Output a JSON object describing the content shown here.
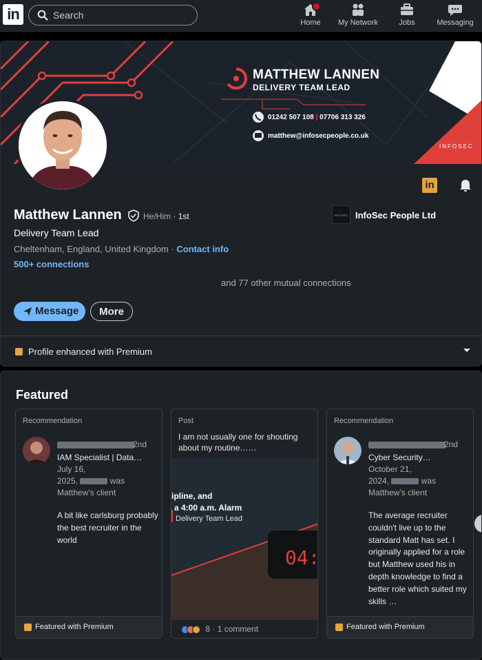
{
  "nav": {
    "search_placeholder": "Search",
    "items": [
      {
        "label": "Home",
        "icon": "home-icon"
      },
      {
        "label": "My Network",
        "icon": "network-icon"
      },
      {
        "label": "Jobs",
        "icon": "briefcase-icon"
      },
      {
        "label": "Messaging",
        "icon": "messaging-icon"
      }
    ],
    "logo_text": "in"
  },
  "banner": {
    "name": "MATTHEW LANNEN",
    "title": "DELIVERY TEAM LEAD",
    "phone": "01242 507 108",
    "phone_sep": "|",
    "mobile": "07706 313 326",
    "email": "matthew@infosecpeople.co.uk",
    "brand": "INFOSEC"
  },
  "profile": {
    "name": "Matthew Lannen",
    "pronouns": "He/Him",
    "degree": "· 1st",
    "headline": "Delivery Team Lead",
    "location": "Cheltenham, England, United Kingdom · ",
    "contact_link": "Contact info",
    "connections": "500+ connections",
    "mutual": "and 77 other mutual connections",
    "company": "InfoSec People Ltd",
    "company_logo_text": "INFOSEC",
    "message_btn": "Message",
    "more_btn": "More",
    "premium_note": "Profile enhanced with Premium"
  },
  "featured": {
    "title": "Featured",
    "cards": [
      {
        "type": "Recommendation",
        "degree": "2nd",
        "role": "IAM Specialist | Data…",
        "date_line1": "July 16,",
        "date_line2_pre": "2025,",
        "date_line2_post": "was",
        "relation": "Matthew’s client",
        "body": "A bit like carlsburg probably the best recruiter in the world",
        "footer": "Featured with Premium"
      },
      {
        "type": "Post",
        "text": "I am not usually one for shouting about my routine……",
        "img_line1": "ipline, and",
        "img_line2": "a 4:00 a.m. Alarm",
        "img_line3": "Delivery Team Lead",
        "clock": "04:",
        "reactions": "8",
        "comments": "· 1 comment"
      },
      {
        "type": "Recommendation",
        "degree": "2nd",
        "role": "Cyber Security…",
        "date_line1": "October 21,",
        "date_line2_pre": "2024,",
        "date_line2_post": "was",
        "relation": "Matthew’s client",
        "body": "The average recruiter couldn't live up to the standard Matt has set. I originally applied for a role but Matthew used his in depth knowledge to find a better role which suited my skills …",
        "footer": "Featured with Premium"
      }
    ]
  },
  "colors": {
    "accent": "#71b7fb",
    "premium": "#e7a33e",
    "brand_red": "#e0403a",
    "card_bg": "#1d2226"
  }
}
